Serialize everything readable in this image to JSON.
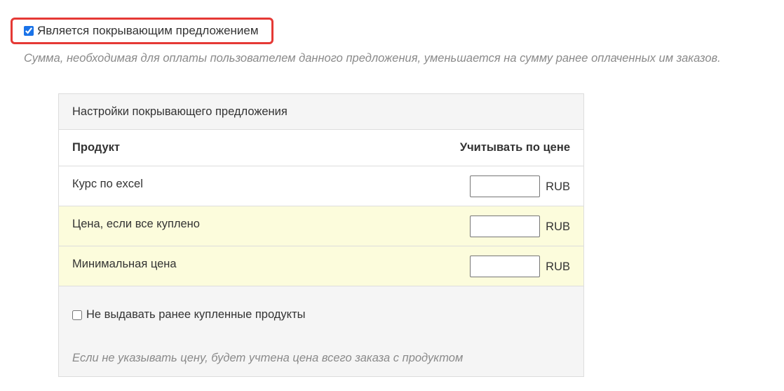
{
  "covering_offer": {
    "checkbox_label": "Является покрывающим предложением",
    "checked": true,
    "hint": "Сумма, необходимая для оплаты пользователем данного предложения, уменьшается на сумму ранее оплаченных им заказов."
  },
  "settings": {
    "title": "Настройки покрывающего предложения",
    "columns": {
      "product": "Продукт",
      "price": "Учитывать по цене"
    },
    "rows": [
      {
        "name": "Курс по excel",
        "price_value": "",
        "currency": "RUB"
      },
      {
        "name": "Цена, если все куплено",
        "price_value": "",
        "currency": "RUB"
      },
      {
        "name": "Минимальная цена",
        "price_value": "",
        "currency": "RUB"
      }
    ],
    "no_issue_label": "Не выдавать ранее купленные продукты",
    "no_issue_checked": false,
    "bottom_hint": "Если не указывать цену, будет учтена цена всего заказа с продуктом"
  },
  "colors": {
    "highlight_border": "#e53935",
    "row_highlight": "#fcfcdc",
    "panel_background": "#f5f5f5"
  }
}
